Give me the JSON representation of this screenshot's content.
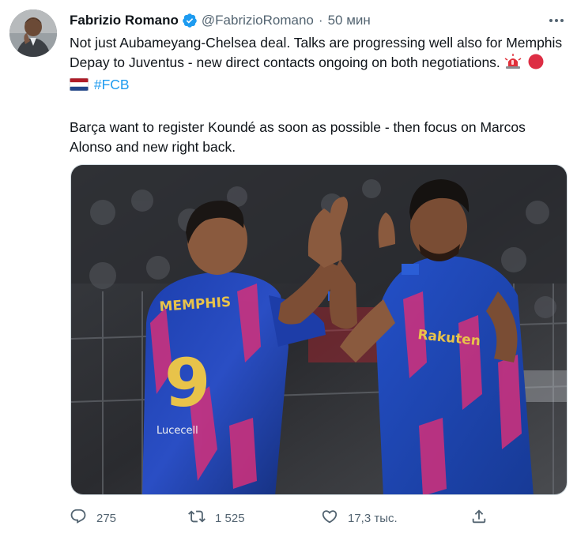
{
  "author": {
    "name": "Fabrizio Romano",
    "handle": "@FabrizioRomano",
    "separator": "·",
    "time": "50 мин"
  },
  "tweet": {
    "paragraph1": "Not just Aubameyang-Chelsea deal. Talks are progressing well also for Memphis Depay to Juventus - new direct contacts ongoing on both negotiations.",
    "hashtag": "#FCB",
    "paragraph2": "Barça want to register Koundé as soon as possible - then focus on Marcos Alonso and new right back."
  },
  "media": {
    "jersey_left_name": "MEMPHIS",
    "jersey_left_number": "9",
    "jersey_left_sponsor": "Lucecell",
    "jersey_right_sponsor": "Rakuten"
  },
  "actions": {
    "reply_count": "275",
    "retweet_count": "1 525",
    "like_count": "17,3 тыс."
  },
  "icons": {
    "verified": "verified-badge-icon",
    "more": "more-dots-icon",
    "reply": "reply-icon",
    "retweet": "retweet-icon",
    "like": "heart-icon",
    "share": "share-icon"
  },
  "colors": {
    "accent": "#1d9bf0",
    "secondary_text": "#536471",
    "primary_text": "#0f1419"
  }
}
